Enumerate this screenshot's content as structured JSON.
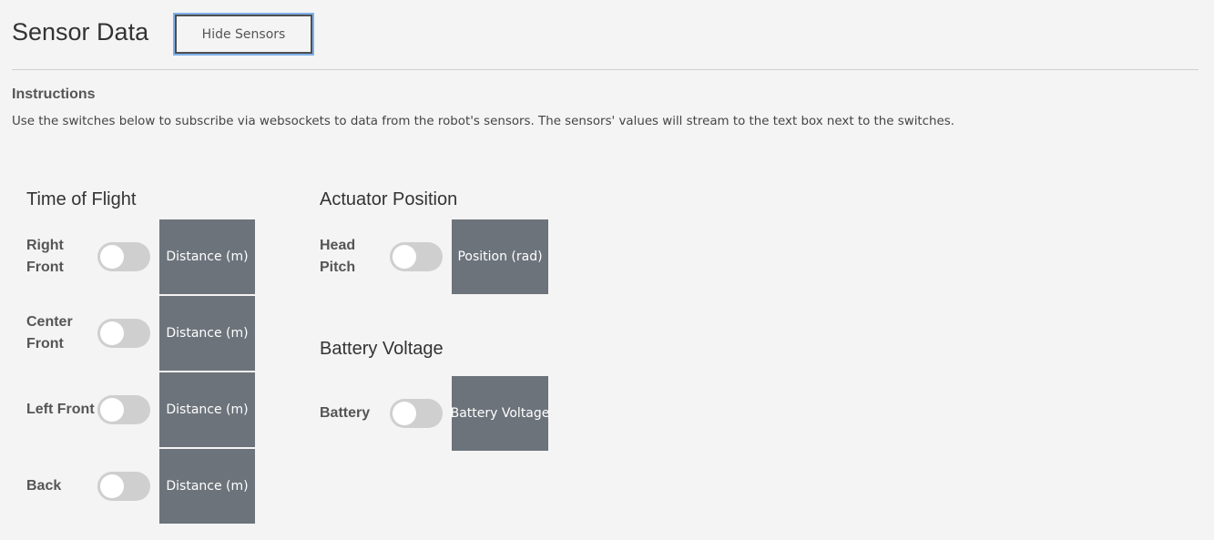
{
  "header": {
    "title": "Sensor Data",
    "toggle_button_label": "Hide Sensors"
  },
  "instructions": {
    "heading": "Instructions",
    "text": "Use the switches below to subscribe via websockets to data from the robot's sensors. The sensors' values will stream to the text box next to the switches."
  },
  "time_of_flight": {
    "title": "Time of Flight",
    "rows": [
      {
        "label": "Right Front",
        "value": "Distance (m)",
        "enabled": false
      },
      {
        "label": "Center Front",
        "value": "Distance (m)",
        "enabled": false
      },
      {
        "label": "Left Front",
        "value": "Distance (m)",
        "enabled": false
      },
      {
        "label": "Back",
        "value": "Distance (m)",
        "enabled": false
      }
    ]
  },
  "actuator_position": {
    "title": "Actuator Position",
    "rows": [
      {
        "label": "Head Pitch",
        "value": "Position (rad)",
        "enabled": false
      }
    ]
  },
  "battery_voltage": {
    "title": "Battery Voltage",
    "rows": [
      {
        "label": "Battery",
        "value": "Battery Voltage",
        "enabled": false
      }
    ]
  },
  "colors": {
    "background": "#f4f4f4",
    "value_box": "#6c737b",
    "toggle_off": "#cfcfcf",
    "focus_ring": "#7fb0ea"
  }
}
